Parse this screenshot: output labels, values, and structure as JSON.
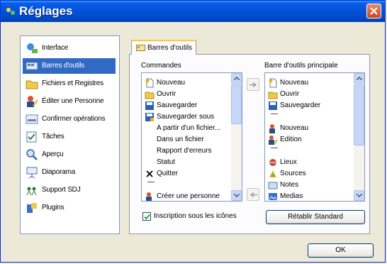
{
  "window": {
    "title": "Réglages"
  },
  "nav": {
    "items": [
      {
        "label": "Interface",
        "icon": "interface-icon"
      },
      {
        "label": "Barres d'outils",
        "icon": "toolbar-icon",
        "selected": true
      },
      {
        "label": "Fichiers et Registres",
        "icon": "folder-icon"
      },
      {
        "label": "Éditer une Personne",
        "icon": "edit-person-icon"
      },
      {
        "label": "Confirmer opérations",
        "icon": "confirm-icon"
      },
      {
        "label": "Tâches",
        "icon": "tasks-icon"
      },
      {
        "label": "Aperçu",
        "icon": "preview-icon"
      },
      {
        "label": "Diaporama",
        "icon": "slideshow-icon"
      },
      {
        "label": "Support SDJ",
        "icon": "support-icon"
      },
      {
        "label": "Plugins",
        "icon": "plugins-icon"
      }
    ]
  },
  "tab": {
    "label": "Barres d'outils"
  },
  "commands": {
    "label": "Commandes",
    "items": [
      {
        "label": "Nouveau",
        "icon": "new-icon"
      },
      {
        "label": "Ouvrir",
        "icon": "open-icon"
      },
      {
        "label": "Sauvegarder",
        "icon": "save-icon"
      },
      {
        "label": "Sauvegarder sous",
        "icon": "save-as-icon"
      },
      {
        "label": "A partir d'un fichier...",
        "icon": ""
      },
      {
        "label": "Dans un fichier",
        "icon": ""
      },
      {
        "label": "Rapport d'erreurs",
        "icon": ""
      },
      {
        "label": "Statut",
        "icon": ""
      },
      {
        "label": "Quitter",
        "icon": "quit-icon"
      },
      {
        "label": "—",
        "icon": "separator"
      },
      {
        "label": "Créer une personne",
        "icon": "person-icon"
      }
    ]
  },
  "main_toolbar": {
    "label": "Barre d'outils principale",
    "items": [
      {
        "label": "Nouveau",
        "icon": "new-icon"
      },
      {
        "label": "Ouvrir",
        "icon": "open-icon"
      },
      {
        "label": "Sauvegarder",
        "icon": "save-icon"
      },
      {
        "label": "—",
        "icon": "separator"
      },
      {
        "label": "Nouveau",
        "icon": "person-new-icon"
      },
      {
        "label": "Edition",
        "icon": "person-edit-icon"
      },
      {
        "label": "—",
        "icon": "separator"
      },
      {
        "label": "Lieux",
        "icon": "places-icon"
      },
      {
        "label": "Sources",
        "icon": "sources-icon"
      },
      {
        "label": "Notes",
        "icon": "notes-icon"
      },
      {
        "label": "Medias",
        "icon": "media-icon"
      }
    ]
  },
  "checkbox": {
    "label": "Inscription sous les icônes",
    "checked": true
  },
  "buttons": {
    "restore": "Rétablir Standard",
    "ok": "OK"
  }
}
